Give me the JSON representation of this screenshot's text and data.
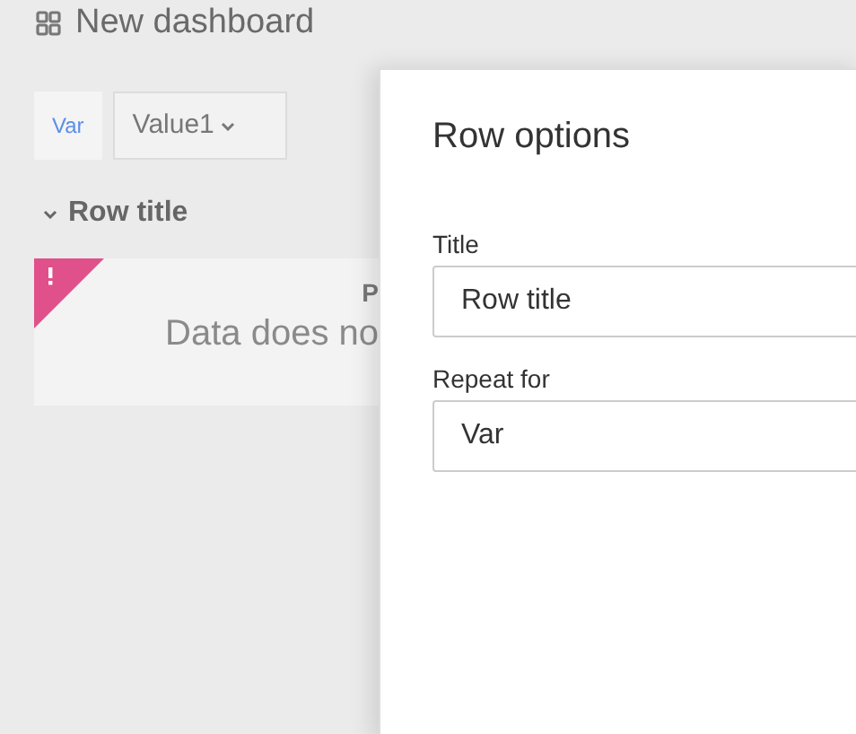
{
  "header": {
    "title": "New dashboard"
  },
  "variable": {
    "label": "Var",
    "value": "Value1"
  },
  "row": {
    "title": "Row title",
    "expanded": true
  },
  "panel": {
    "title": "P",
    "message": "Data does no",
    "error": true
  },
  "dialog": {
    "title": "Row options",
    "fields": [
      {
        "label": "Title",
        "value": "Row title"
      },
      {
        "label": "Repeat for",
        "value": "Var"
      }
    ]
  }
}
